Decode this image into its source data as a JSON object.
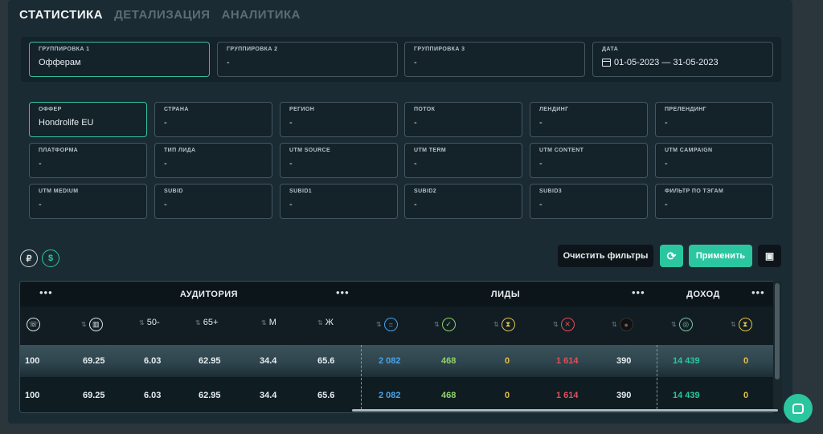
{
  "tabs": [
    "СТАТИСТИКА",
    "ДЕТАЛИЗАЦИЯ",
    "АНАЛИТИКА"
  ],
  "grouping": [
    {
      "label": "ГРУППИРОВКА 1",
      "value": "Офферам"
    },
    {
      "label": "ГРУППИРОВКА 2",
      "value": "-"
    },
    {
      "label": "ГРУППИРОВКА 3",
      "value": "-"
    },
    {
      "label": "ДАТА",
      "value": "01-05-2023 — 31-05-2023"
    }
  ],
  "filters": [
    {
      "label": "ОФФЕР",
      "value": "Hondrolife EU"
    },
    {
      "label": "СТРАНА",
      "value": "-"
    },
    {
      "label": "РЕГИОН",
      "value": "-"
    },
    {
      "label": "ПОТОК",
      "value": "-"
    },
    {
      "label": "ЛЕНДИНГ",
      "value": "-"
    },
    {
      "label": "ПРЕЛЕНДИНГ",
      "value": "-"
    },
    {
      "label": "ПЛАТФОРМА",
      "value": "-"
    },
    {
      "label": "ТИП ЛИДА",
      "value": "-"
    },
    {
      "label": "UTM SOURCE",
      "value": "-"
    },
    {
      "label": "UTM TERM",
      "value": "-"
    },
    {
      "label": "UTM CONTENT",
      "value": "-"
    },
    {
      "label": "UTM CAMPAIGN",
      "value": "-"
    },
    {
      "label": "UTM MEDIUM",
      "value": "-"
    },
    {
      "label": "SUBID",
      "value": "-"
    },
    {
      "label": "SUBID1",
      "value": "-"
    },
    {
      "label": "SUBID2",
      "value": "-"
    },
    {
      "label": "SUBID3",
      "value": "-"
    },
    {
      "label": "ФИЛЬТР ПО ТЭГАМ",
      "value": "-"
    }
  ],
  "currency": {
    "rub": "₽",
    "usd": "$"
  },
  "buttons": {
    "clear": "Очистить фильтры",
    "refresh": "⟳",
    "apply": "Применить",
    "save": "▣"
  },
  "table": {
    "groups": {
      "audience": "АУДИТОРИЯ",
      "leads": "ЛИДЫ",
      "income": "ДОХОД",
      "dots": "•••"
    },
    "columns": {
      "age1": "50-",
      "age2": "65+",
      "male": "М",
      "female": "Ж"
    },
    "rows": [
      {
        "c0": "100",
        "c1": "69.25",
        "c2": "6.03",
        "c3": "62.95",
        "c4": "34.4",
        "c5": "65.6",
        "c6": "2 082",
        "c7": "468",
        "c8": "0",
        "c9": "1 614",
        "c10": "390",
        "c11": "14 439",
        "c12": "0"
      },
      {
        "c0": "100",
        "c1": "69.25",
        "c2": "6.03",
        "c3": "62.95",
        "c4": "34.4",
        "c5": "65.6",
        "c6": "2 082",
        "c7": "468",
        "c8": "0",
        "c9": "1 614",
        "c10": "390",
        "c11": "14 439",
        "c12": "0"
      }
    ]
  },
  "colors": {
    "accent": "#2bc6a0",
    "blue": "#4aa3e8",
    "green": "#8fd36a",
    "yellow": "#e3c24a",
    "red": "#e0505a"
  }
}
